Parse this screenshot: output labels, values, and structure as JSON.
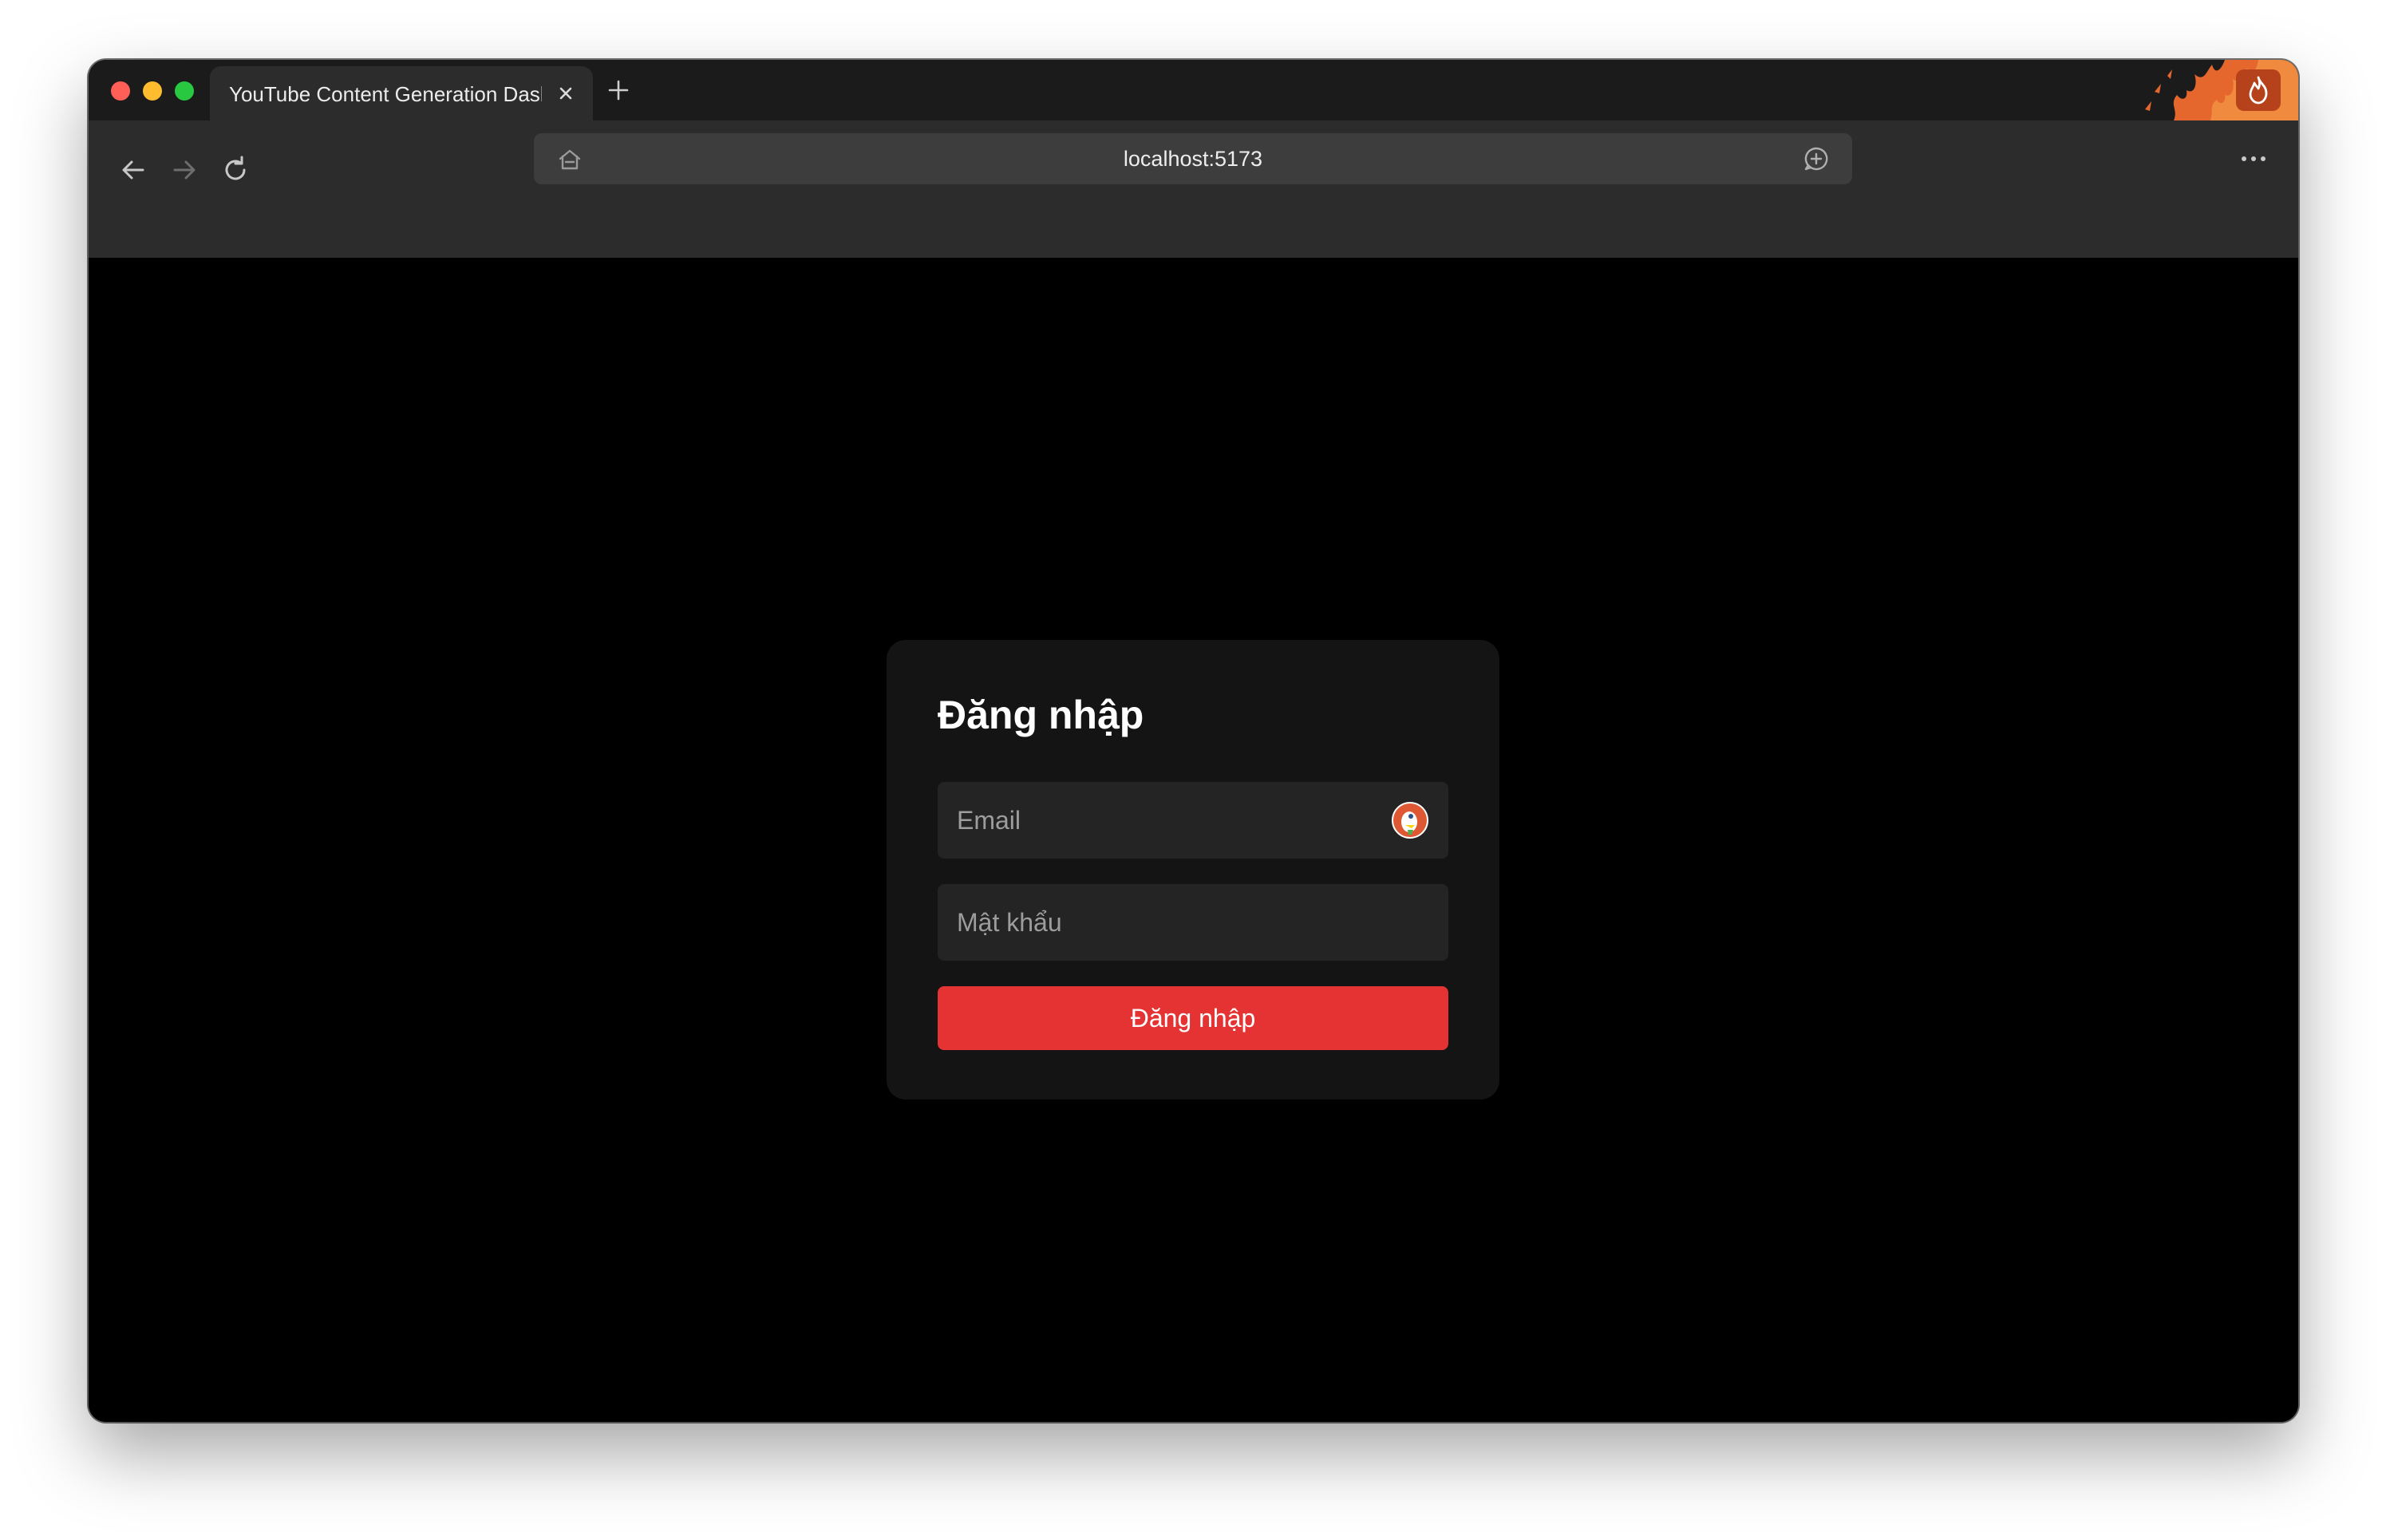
{
  "browser": {
    "tab": {
      "title": "YouTube Content Generation Dashboard",
      "close_icon": "close-icon"
    },
    "new_tab_icon": "plus-icon",
    "address_bar": {
      "url": "localhost:5173"
    },
    "icons": {
      "back": "arrow-left-icon",
      "forward": "arrow-right-icon",
      "reload": "reload-icon",
      "home": "home-icon",
      "chat": "chat-icon",
      "menu": "more-horizontal-icon",
      "fire": "flame-icon"
    }
  },
  "login": {
    "title": "Đăng nhập",
    "email_placeholder": "Email",
    "password_placeholder": "Mật khẩu",
    "submit_label": "Đăng nhập"
  },
  "colors": {
    "page_background": "#000000",
    "card_background": "#141414",
    "input_background": "#242424",
    "primary_button": "#e53333",
    "tab_strip": "#1b1b1b",
    "toolbar": "#2c2c2c",
    "fire_button": "#b6421c"
  }
}
